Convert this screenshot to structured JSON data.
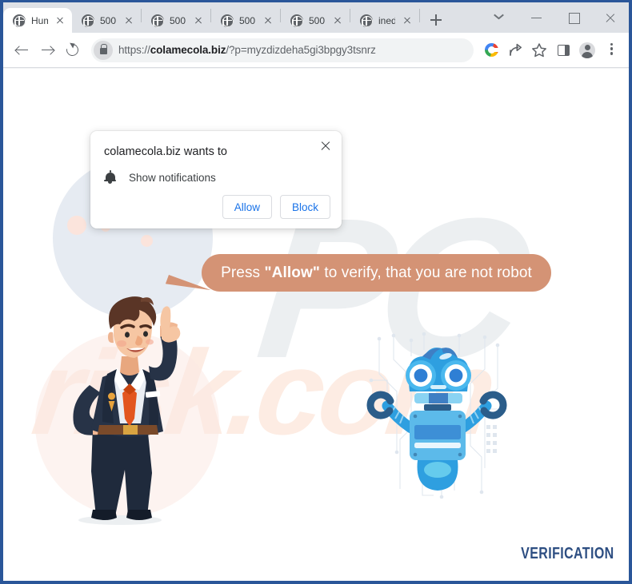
{
  "browser": {
    "tabs": [
      {
        "title": "Hum",
        "favicon": "globe-icon",
        "active": true
      },
      {
        "title": "500",
        "favicon": "globe-icon",
        "active": false
      },
      {
        "title": "500",
        "favicon": "globe-icon",
        "active": false
      },
      {
        "title": "500",
        "favicon": "globe-icon",
        "active": false
      },
      {
        "title": "500",
        "favicon": "globe-icon",
        "active": false
      },
      {
        "title": "ined",
        "favicon": "globe-icon",
        "active": false
      }
    ],
    "new_tab_label": "+",
    "window_controls": {
      "tab_search": "tab-search-chevron",
      "minimize": "minimize",
      "maximize": "maximize",
      "close": "close"
    },
    "toolbar": {
      "back": "back-arrow",
      "forward": "forward-arrow",
      "reload": "reload",
      "lock": "lock-icon",
      "url_scheme": "https://",
      "url_domain": "colamecola.biz",
      "url_path": "/?p=myzdizdeha5gi3bpgy3tsnrz",
      "url_full": "https://colamecola.biz/?p=myzdizdeha5gi3bpgy3tsnrz",
      "icons": [
        "google-icon",
        "share-icon",
        "bookmark-star-icon",
        "side-panel-icon",
        "profile-avatar-icon",
        "chrome-menu-icon"
      ]
    }
  },
  "permission_dialog": {
    "title": "colamecola.biz wants to",
    "permission_label": "Show notifications",
    "permission_icon": "bell-icon",
    "allow_label": "Allow",
    "block_label": "Block",
    "close_label": "×"
  },
  "page": {
    "bubble_prefix": "Press ",
    "bubble_emphasis": "\"Allow\"",
    "bubble_suffix": " to verify, that you are not robot",
    "verification_label": "VERIFICATION",
    "watermark_primary": "PC",
    "watermark_secondary": "risk.com",
    "characters": [
      "businessman-pointing",
      "blue-robot"
    ]
  },
  "colors": {
    "window_border": "#2a5699",
    "tabstrip": "#dee1e6",
    "omnibox": "#f1f3f4",
    "link_blue": "#1a73e8",
    "bubble": "#d49375",
    "verification": "#2d4e82",
    "suit_navy": "#273347",
    "tie_orange": "#e2551f",
    "robot_blue": "#3fa9f5"
  }
}
